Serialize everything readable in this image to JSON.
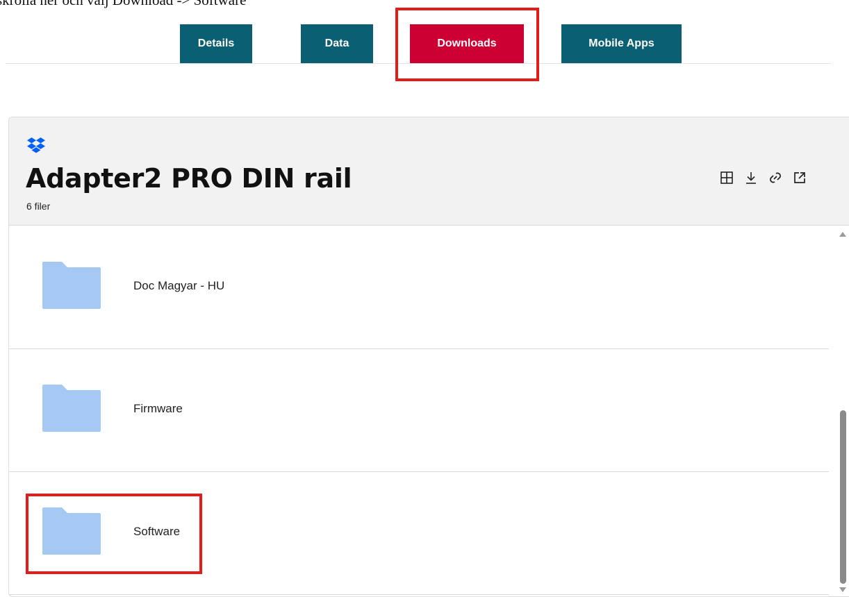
{
  "caption": "skrolla ner och välj Download -> Software",
  "tabs": [
    {
      "label": "Details"
    },
    {
      "label": "Data"
    },
    {
      "label": "Downloads"
    },
    {
      "label": "Mobile Apps"
    }
  ],
  "active_tab": "Downloads",
  "folder": {
    "title": "Adapter2 PRO DIN rail",
    "file_count": "6 filer"
  },
  "header_actions": [
    "grid-icon",
    "download-icon",
    "link-icon",
    "open-external-icon"
  ],
  "items": [
    {
      "name": "Doc Magyar - HU"
    },
    {
      "name": "Firmware"
    },
    {
      "name": "Software"
    }
  ],
  "colors": {
    "tab_teal": "#0b5f72",
    "tab_active": "#cc0033",
    "highlight": "#e31b1b",
    "folder_blue": "#a6c9f4",
    "dropbox_blue": "#0061fe"
  }
}
